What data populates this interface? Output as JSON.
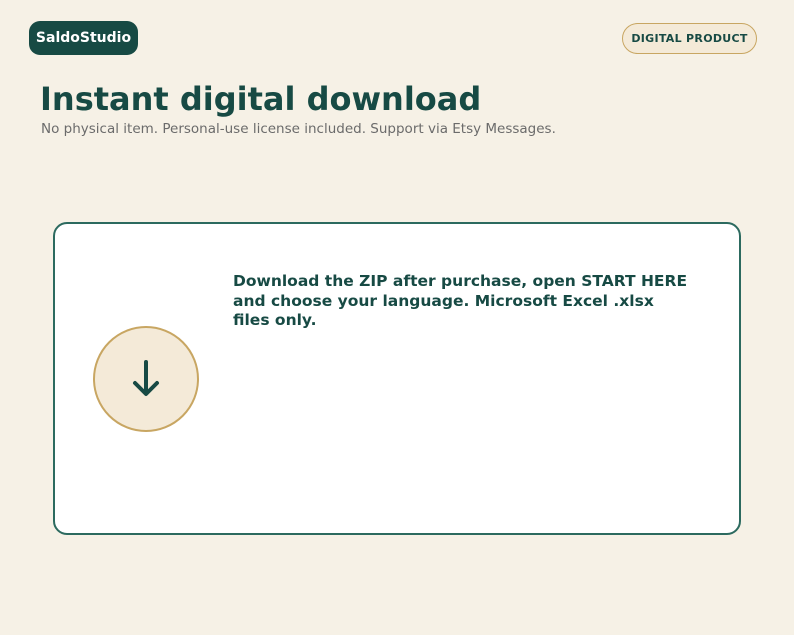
{
  "header": {
    "brand": "SaldoStudio",
    "badge": "DIGITAL PRODUCT"
  },
  "hero": {
    "title": "Instant digital download",
    "subtitle": "No physical item. Personal-use license included. Support via Etsy Messages."
  },
  "card": {
    "icon": "download-arrow-icon",
    "text": "Download the ZIP after purchase, open START HERE and choose your language. Microsoft Excel .xlsx files only."
  },
  "colors": {
    "background": "#f6f1e6",
    "brand_green": "#174a44",
    "gold": "#c8a662",
    "cream": "#f4ead8"
  }
}
